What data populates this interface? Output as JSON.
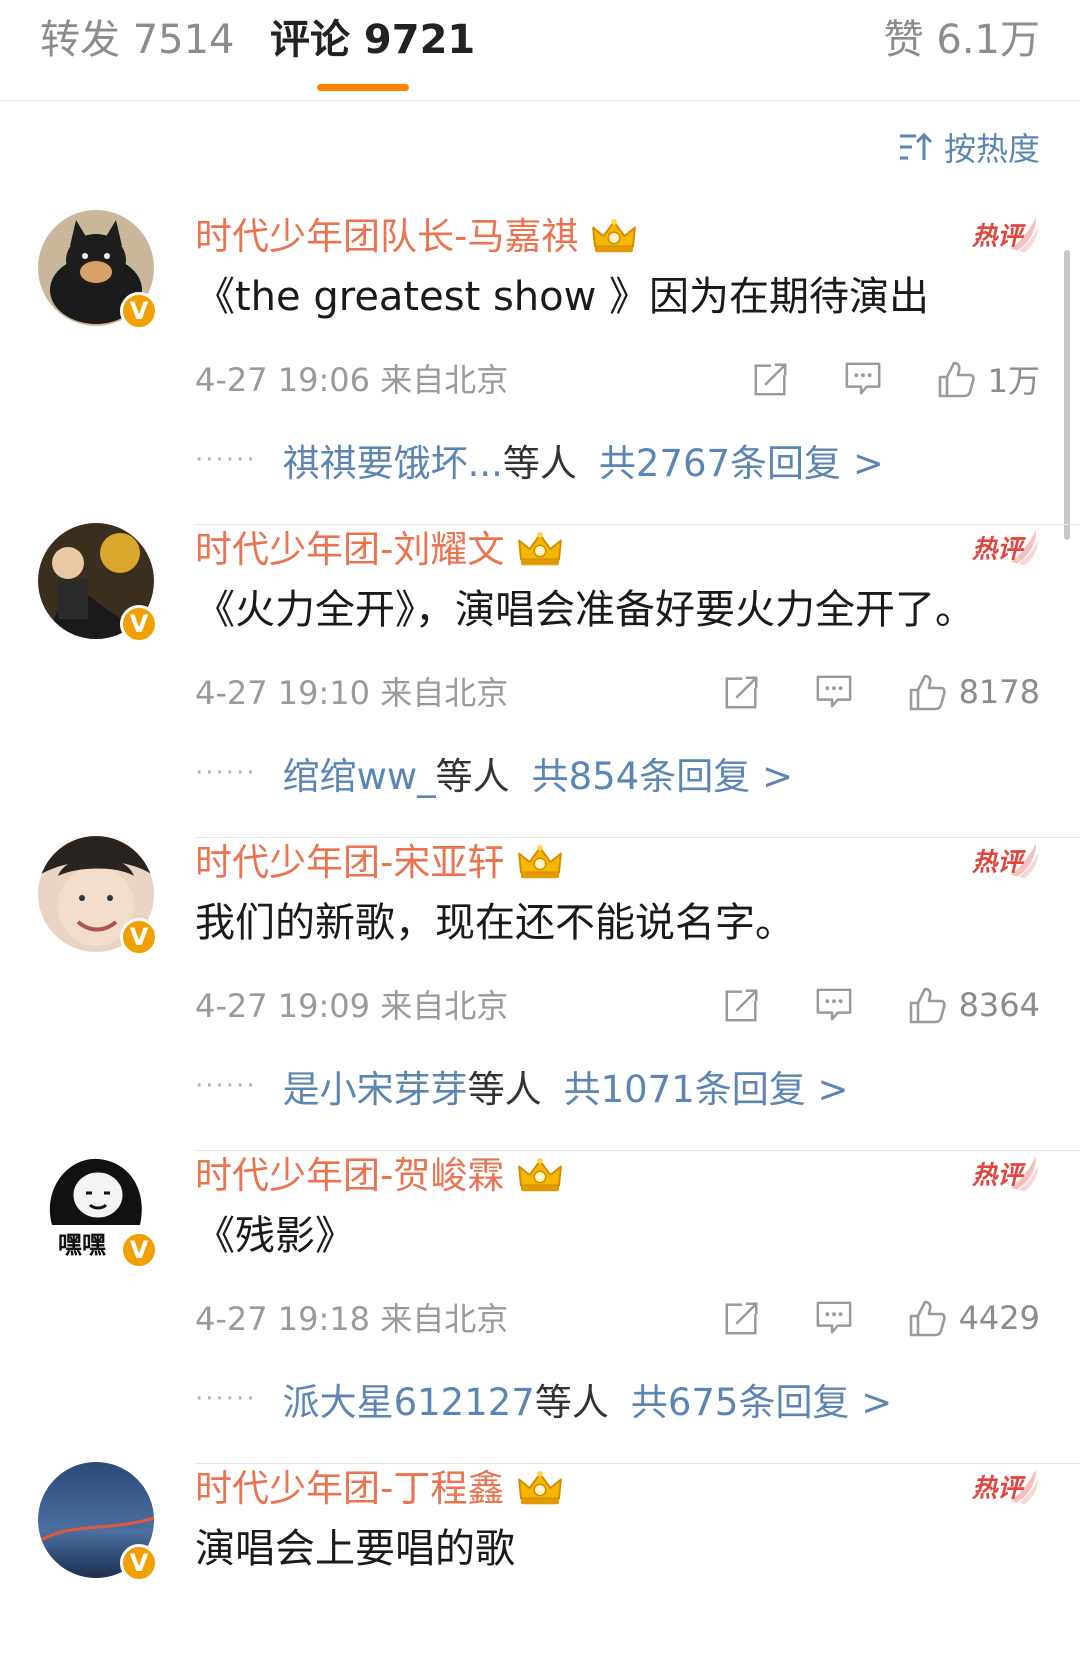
{
  "tabs": {
    "repost_label": "转发 7514",
    "comments_label": "评论 9721",
    "likes_label": "赞 6.1万"
  },
  "sort": {
    "label": "按热度"
  },
  "hot_badge": "热评",
  "comments": [
    {
      "name": "时代少年团队长-马嘉祺",
      "text": "《the greatest show 》因为在期待演出",
      "meta": "4-27 19:06  来自北京",
      "likes": "1万",
      "reply_users": "祺祺要饿坏...",
      "reply_suffix": "等人",
      "reply_link": "共2767条回复 >"
    },
    {
      "name": "时代少年团-刘耀文",
      "text": "《火力全开》，演唱会准备好要火力全开了。",
      "meta": "4-27 19:10  来自北京",
      "likes": "8178",
      "reply_users": "绾绾ww_",
      "reply_suffix": "等人",
      "reply_link": "共854条回复 >"
    },
    {
      "name": "时代少年团-宋亚轩",
      "text": "我们的新歌，现在还不能说名字。",
      "meta": "4-27 19:09  来自北京",
      "likes": "8364",
      "reply_users": "是小宋芽芽",
      "reply_suffix": "等人",
      "reply_link": "共1071条回复 >"
    },
    {
      "name": "时代少年团-贺峻霖",
      "text": "《残影》",
      "meta": "4-27 19:18  来自北京",
      "likes": "4429",
      "reply_users": "派大星612127",
      "reply_suffix": "等人",
      "reply_link": "共675条回复 >"
    },
    {
      "name": "时代少年团-丁程鑫",
      "text": "演唱会上要唱的歌"
    }
  ],
  "avatar_4_text": "嘿嘿",
  "colors": {
    "accent_orange": "#ff8200",
    "name_orange": "#eb7350",
    "link_blue": "#5b86b3",
    "hot_red": "#e0453f",
    "badge_gold": "#f2a000"
  },
  "icons": [
    "sort-icon",
    "vip-crown-icon",
    "hot-comment-badge",
    "share-icon",
    "comment-icon",
    "like-icon",
    "verified-badge"
  ]
}
